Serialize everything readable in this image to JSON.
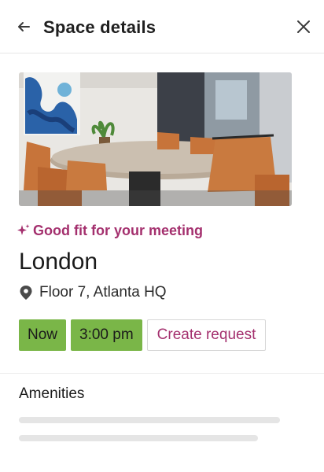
{
  "header": {
    "title": "Space details",
    "back_icon": "arrow-left-icon",
    "close_icon": "close-icon"
  },
  "space": {
    "fit_label": "Good fit for your meeting",
    "fit_icon": "sparkle-icon",
    "name": "London",
    "location": "Floor 7, Atlanta HQ",
    "location_icon": "map-pin-icon"
  },
  "time_options": {
    "now_label": "Now",
    "time_label": "3:00 pm",
    "create_request_label": "Create request"
  },
  "amenities": {
    "title": "Amenities"
  },
  "colors": {
    "accent": "#a4306e",
    "chip_green": "#7ab648"
  }
}
